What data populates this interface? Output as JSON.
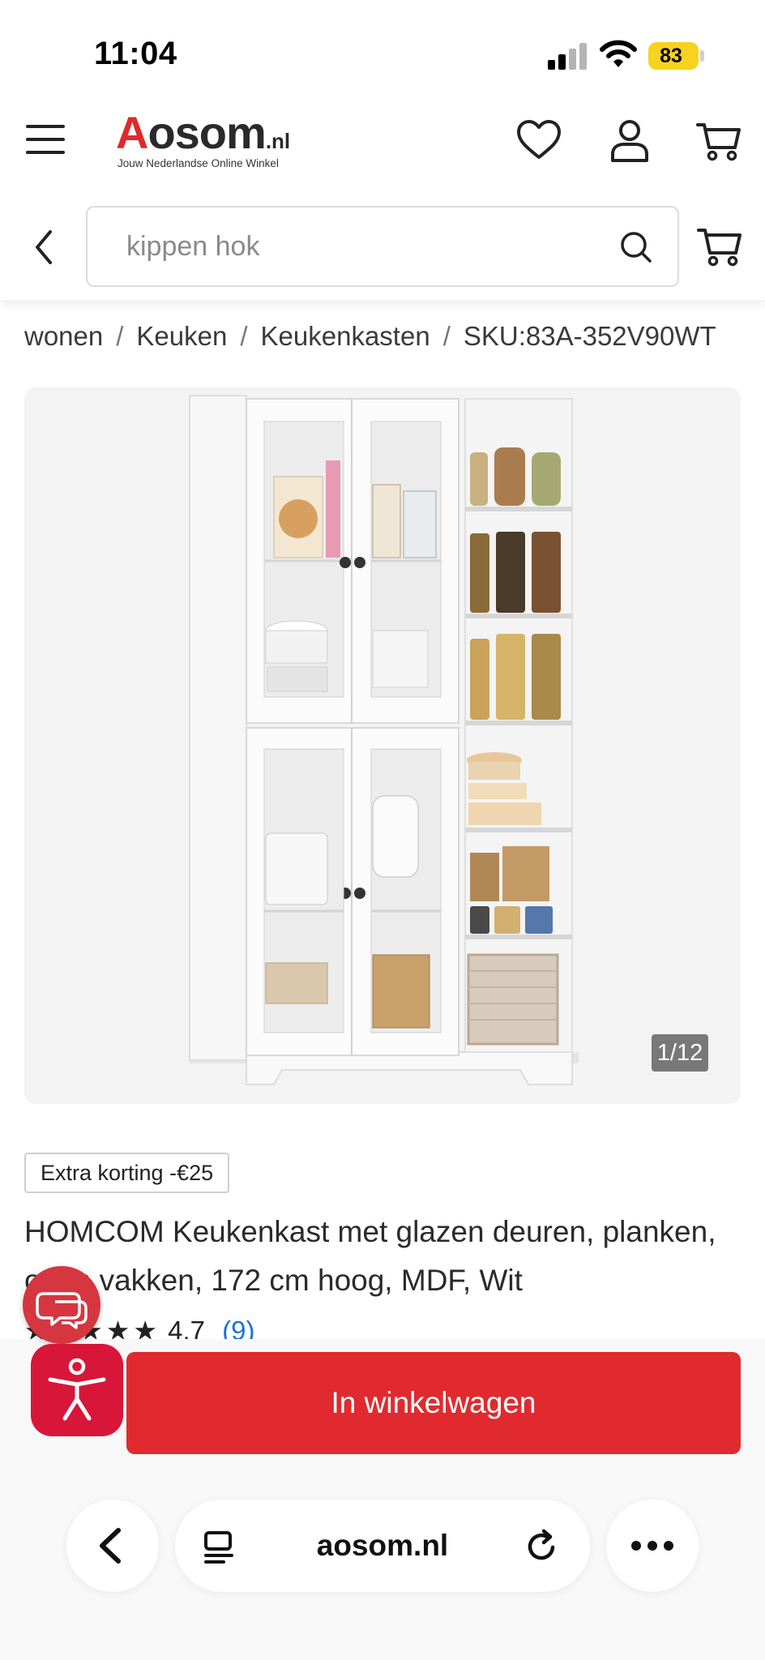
{
  "status_bar": {
    "time": "11:04",
    "battery": "83"
  },
  "header": {
    "logo_name": "osom",
    "logo_letter": "A",
    "logo_tld": ".nl",
    "logo_tagline": "Jouw Nederlandse Online Winkel",
    "icons": [
      "menu-icon",
      "heart-icon",
      "user-icon",
      "cart-icon"
    ]
  },
  "search": {
    "value": "kippen hok"
  },
  "breadcrumb": {
    "items": [
      "wonen",
      "Keuken",
      "Keukenkasten",
      "SKU:83A-352V90WT"
    ],
    "separator": "/"
  },
  "gallery": {
    "counter": "1/12"
  },
  "product": {
    "badge": "Extra korting -€25",
    "title": "HOMCOM Keukenkast met glazen deuren, planken, open vakken, 172 cm hoog, MDF, Wit",
    "rating_value": "4.7",
    "rating_count": "(9)",
    "stars_filled": 4.5
  },
  "actions": {
    "add_to_cart": "In winkelwagen"
  },
  "browser": {
    "url": "aosom.nl"
  },
  "colors": {
    "brand_red": "#e02a2f",
    "battery_yellow": "#f7d21e",
    "link_blue": "#1b73d6"
  }
}
